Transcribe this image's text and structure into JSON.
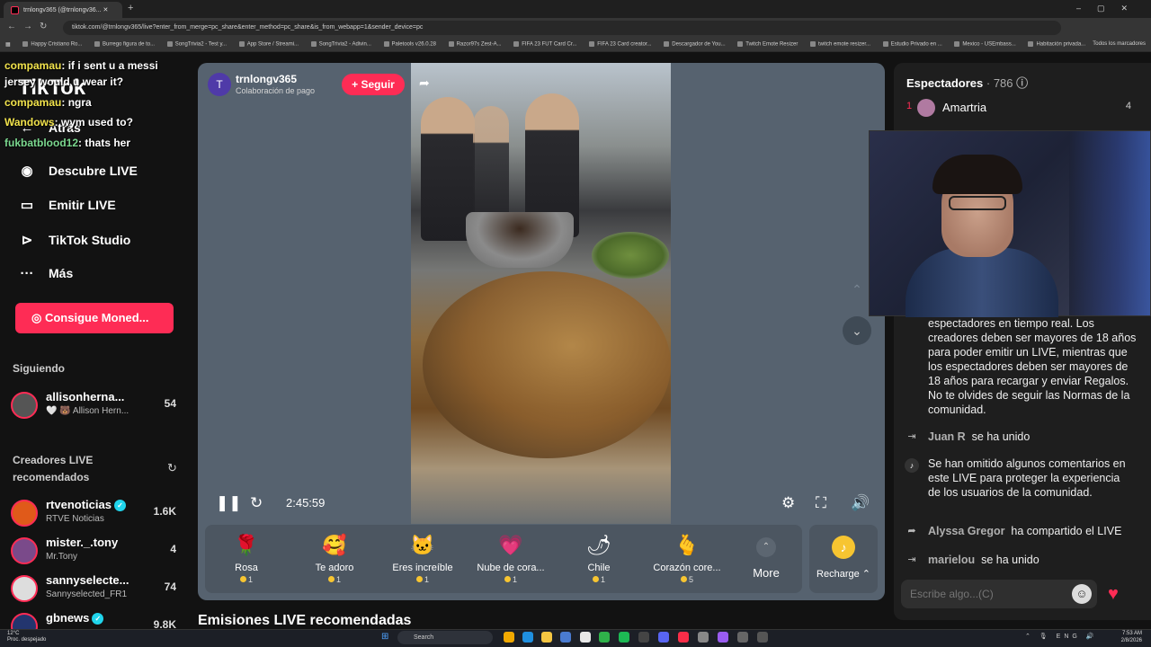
{
  "browser": {
    "tab_title": "trnlongv365 (@trnlongv36...",
    "new_tab": "+",
    "url": "tiktok.com/@trnlongv365/live?enter_from_merge=pc_share&enter_method=pc_share&is_from_webapp=1&sender_device=pc",
    "bookmarks": [
      "Happy Cristiano Ro...",
      "Burrego figura de to...",
      "SongTrivia2 - Test y...",
      "App Store / Streami...",
      "SongTrivia2 - Adivin...",
      "Paletools v26.0.28",
      "Razor97s Zest-A...",
      "FIFA 23 FUT Card Cr...",
      "FIFA 23 Card creator...",
      "Descargador de You...",
      "Twitch Emote Resizer",
      "twitch emote resizer...",
      "Estudio Privado en ...",
      "Mexico - USEmbass...",
      "Habitación privada..."
    ],
    "all_bookmarks": "Todos los marcadores"
  },
  "chat_overlay": [
    {
      "user": "compamau",
      "text": ": if i sent u a messi"
    },
    {
      "user": "",
      "text": "jersey would u wear it?"
    },
    {
      "user": "compamau",
      "text": ": ngra"
    },
    {
      "user": "Wandows",
      "text": ": wym used to?"
    },
    {
      "user": "fukbatblood12",
      "text": ": thats her"
    }
  ],
  "sidebar": {
    "logo": "TikTok",
    "back": "Atrás",
    "items": [
      {
        "label": "Descubre LIVE",
        "icon": "live-icon"
      },
      {
        "label": "Emitir LIVE",
        "icon": "camera-icon"
      },
      {
        "label": "TikTok Studio",
        "icon": "studio-icon"
      },
      {
        "label": "Más",
        "icon": "more-icon"
      }
    ],
    "coins_button": "Consigue Moned...",
    "following_title": "Siguiendo",
    "following": [
      {
        "name": "allisonherna...",
        "sub": "🤍 🐻 Allison Hern...",
        "count": "54"
      }
    ],
    "recommended_title_1": "Creadores LIVE",
    "recommended_title_2": "recomendados",
    "recommended": [
      {
        "name": "rtvenoticias",
        "sub": "RTVE Noticias",
        "count": "1.6K",
        "verified": true
      },
      {
        "name": "mister._.tony",
        "sub": "Mr.Tony",
        "count": "4",
        "verified": false
      },
      {
        "name": "sannyselecte...",
        "sub": "Sannyselected_FR1",
        "count": "74",
        "verified": false
      },
      {
        "name": "gbnews",
        "sub": "",
        "count": "9.8K",
        "verified": true
      }
    ]
  },
  "player": {
    "host_name": "trnlongv365",
    "host_initial": "T",
    "host_sub": "Colaboración de pago",
    "follow_label": "+ Seguir",
    "timer": "2:45:59",
    "gifts": [
      {
        "name": "Rosa",
        "price": "1",
        "icon": "🌹"
      },
      {
        "name": "Te adoro",
        "price": "1",
        "icon": "🥰"
      },
      {
        "name": "Eres increíble",
        "price": "1",
        "icon": "🐱"
      },
      {
        "name": "Nube de cora...",
        "price": "1",
        "icon": "💗"
      },
      {
        "name": "Chile",
        "price": "1",
        "icon": "🌶"
      },
      {
        "name": "Corazón core...",
        "price": "5",
        "icon": "🫰"
      }
    ],
    "more_label": "More",
    "recharge_label": "Recharge ⌃"
  },
  "recommend_title": "Emisiones LIVE recomendadas",
  "right_panel": {
    "viewers_label": "Espectadores",
    "viewers_count": "· 786",
    "top_viewer": {
      "rank": "1",
      "name": "Amartria",
      "score": "4"
    },
    "rules_text": "espectadores en tiempo real. Los creadores deben ser mayores de 18 años para poder emitir un LIVE, mientras que los espectadores deben ser mayores de 18 años para recargar y enviar Regalos. No te olvides de seguir las Normas de la comunidad.",
    "events": [
      {
        "user": "Juan R",
        "text": "se ha unido"
      },
      {
        "user": "Alyssa Gregor",
        "text": "ha compartido el LIVE"
      },
      {
        "user": "marielou",
        "text": "se ha unido"
      }
    ],
    "omitted_text": "Se han omitido algunos comentarios en este LIVE para proteger la experiencia de los usuarios de la comunidad.",
    "chat_placeholder": "Escribe algo...(C)"
  },
  "taskbar": {
    "weather_temp": "12°C",
    "weather_desc": "Proc. despejado",
    "search": "Search",
    "lang": "ENG",
    "time": "7:53 AM",
    "date": "2/8/2026"
  },
  "colors": {
    "accent": "#fe2c55",
    "player_bg": "#56626f",
    "panel_bg": "#1e1e1e"
  }
}
